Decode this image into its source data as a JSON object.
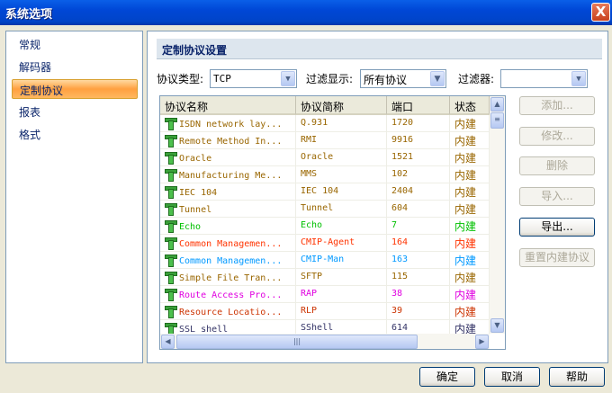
{
  "window": {
    "title": "系统选项",
    "close": "X"
  },
  "sidebar": {
    "items": [
      {
        "label": "常规"
      },
      {
        "label": "解码器"
      },
      {
        "label": "定制协议",
        "selected": true
      },
      {
        "label": "报表"
      },
      {
        "label": "格式"
      }
    ]
  },
  "main": {
    "header": "定制协议设置",
    "filters": {
      "type_label": "协议类型:",
      "type_value": "TCP",
      "display_label": "过滤显示:",
      "display_value": "所有协议",
      "filter_label": "过滤器:",
      "filter_value": ""
    },
    "columns": [
      "协议名称",
      "协议简称",
      "端口",
      "状态"
    ],
    "rows": [
      {
        "name": "ISDN network lay...",
        "abbr": "Q.931",
        "port": "1720",
        "status": "内建",
        "color": "#996600"
      },
      {
        "name": "Remote Method In...",
        "abbr": "RMI",
        "port": "9916",
        "status": "内建",
        "color": "#996600"
      },
      {
        "name": "Oracle",
        "abbr": "Oracle",
        "port": "1521",
        "status": "内建",
        "color": "#996600"
      },
      {
        "name": "Manufacturing Me...",
        "abbr": "MMS",
        "port": "102",
        "status": "内建",
        "color": "#996600"
      },
      {
        "name": "IEC 104",
        "abbr": "IEC 104",
        "port": "2404",
        "status": "内建",
        "color": "#996600"
      },
      {
        "name": "Tunnel",
        "abbr": "Tunnel",
        "port": "604",
        "status": "内建",
        "color": "#996600"
      },
      {
        "name": "Echo",
        "abbr": "Echo",
        "port": "7",
        "status": "内建",
        "color": "#00c000"
      },
      {
        "name": "Common Managemen...",
        "abbr": "CMIP-Agent",
        "port": "164",
        "status": "内建",
        "color": "#ff3300"
      },
      {
        "name": "Common Managemen...",
        "abbr": "CMIP-Man",
        "port": "163",
        "status": "内建",
        "color": "#0099ff"
      },
      {
        "name": "Simple File Tran...",
        "abbr": "SFTP",
        "port": "115",
        "status": "内建",
        "color": "#996600"
      },
      {
        "name": "Route Access Pro...",
        "abbr": "RAP",
        "port": "38",
        "status": "内建",
        "color": "#e000e0"
      },
      {
        "name": "Resource Locatio...",
        "abbr": "RLP",
        "port": "39",
        "status": "内建",
        "color": "#cc3300"
      },
      {
        "name": "SSL shell",
        "abbr": "SShell",
        "port": "614",
        "status": "内建",
        "color": "#333366"
      }
    ],
    "buttons": {
      "add": "添加...",
      "edit": "修改...",
      "delete": "删除",
      "import": "导入...",
      "export": "导出...",
      "reset": "重置内建协议"
    }
  },
  "footer": {
    "ok": "确定",
    "cancel": "取消",
    "help": "帮助"
  }
}
